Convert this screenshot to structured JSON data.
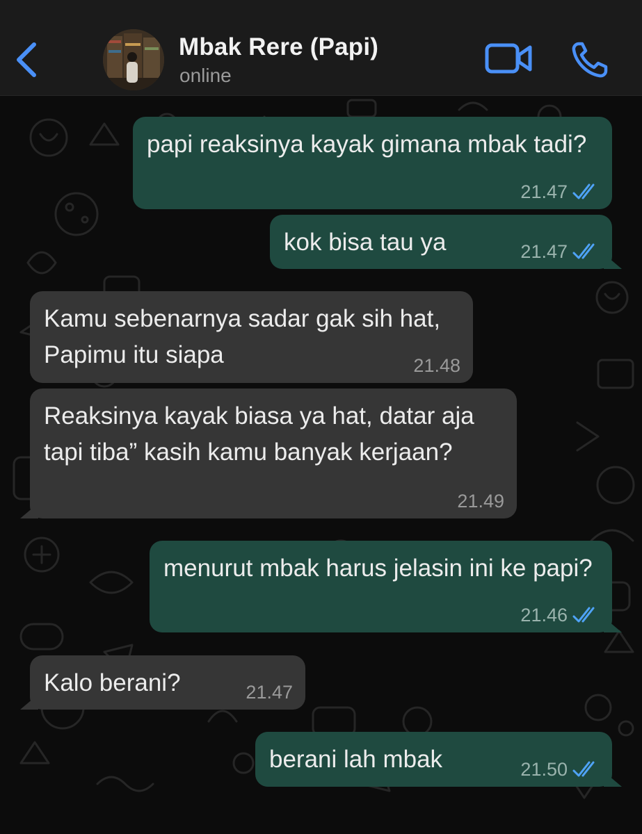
{
  "header": {
    "back_icon": "chevron-left-icon",
    "contact_name": "Mbak Rere (Papi)",
    "status": "online",
    "video_icon": "video-camera-icon",
    "call_icon": "phone-icon",
    "accent_color": "#4a90f7"
  },
  "messages": [
    {
      "direction": "outgoing",
      "text": "papi reaksinya kayak gimana mbak tadi?",
      "time": "21.47",
      "read": true
    },
    {
      "direction": "outgoing",
      "text": "kok bisa tau ya",
      "time": "21.47",
      "read": true
    },
    {
      "direction": "incoming",
      "text": "Kamu sebenarnya sadar gak sih hat, Papimu itu siapa",
      "time": "21.48"
    },
    {
      "direction": "incoming",
      "text": "Reaksinya kayak biasa ya hat, datar aja tapi tiba” kasih kamu banyak kerjaan?",
      "time": "21.49"
    },
    {
      "direction": "outgoing",
      "text": "menurut mbak harus jelasin ini ke papi?",
      "time": "21.46",
      "read": true
    },
    {
      "direction": "incoming",
      "text": "Kalo berani?",
      "time": "21.47"
    },
    {
      "direction": "outgoing",
      "text": "berani lah mbak",
      "time": "21.50",
      "read": true
    }
  ],
  "colors": {
    "outgoing_bubble": "#1f4a40",
    "incoming_bubble": "#363636",
    "read_ticks": "#4fa3f7",
    "header_bg": "#1b1b1b"
  }
}
